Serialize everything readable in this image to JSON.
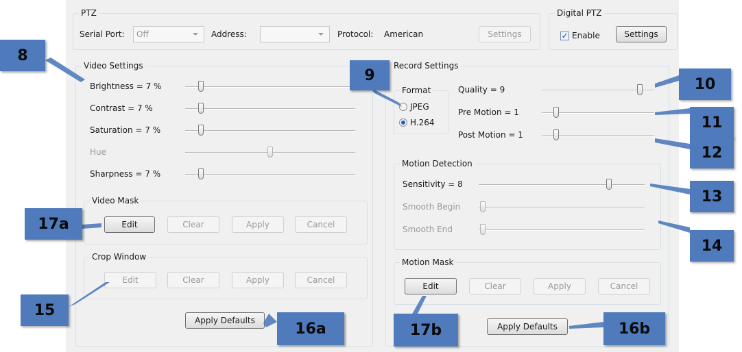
{
  "ptz": {
    "title": "PTZ",
    "serial_port_label": "Serial Port:",
    "serial_port_value": "Off",
    "address_label": "Address:",
    "address_value": "",
    "protocol_label": "Protocol:",
    "protocol_value": "American",
    "settings_label": "Settings"
  },
  "digital_ptz": {
    "title": "Digital PTZ",
    "enable_label": "Enable",
    "enable_checked": true,
    "settings_label": "Settings"
  },
  "video_settings": {
    "title": "Video Settings",
    "sliders": [
      {
        "label": "Brightness = 7 %",
        "value": 7,
        "enabled": true
      },
      {
        "label": "Contrast = 7 %",
        "value": 7,
        "enabled": true
      },
      {
        "label": "Saturation = 7 %",
        "value": 7,
        "enabled": true
      },
      {
        "label": "Hue",
        "value": 50,
        "enabled": false
      },
      {
        "label": "Sharpness = 7 %",
        "value": 7,
        "enabled": true
      }
    ],
    "video_mask": {
      "title": "Video Mask",
      "edit": "Edit",
      "clear": "Clear",
      "apply": "Apply",
      "cancel": "Cancel"
    },
    "crop_window": {
      "title": "Crop Window",
      "edit": "Edit",
      "clear": "Clear",
      "apply": "Apply",
      "cancel": "Cancel"
    },
    "apply_defaults": "Apply Defaults"
  },
  "record_settings": {
    "title": "Record Settings",
    "format": {
      "title": "Format",
      "options": [
        "JPEG",
        "H.264"
      ],
      "selected": "H.264"
    },
    "sliders": [
      {
        "label": "Quality = 9",
        "value": 9,
        "max": 10
      },
      {
        "label": "Pre Motion = 1",
        "value": 1,
        "max": 10
      },
      {
        "label": "Post Motion = 1",
        "value": 1,
        "max": 10
      }
    ],
    "motion_detection": {
      "title": "Motion Detection",
      "sliders": [
        {
          "label": "Sensitivity = 8",
          "value": 8,
          "max": 10,
          "enabled": true
        },
        {
          "label": "Smooth Begin",
          "value": 0,
          "max": 10,
          "enabled": false
        },
        {
          "label": "Smooth End",
          "value": 0,
          "max": 10,
          "enabled": false
        }
      ]
    },
    "motion_mask": {
      "title": "Motion Mask",
      "edit": "Edit",
      "clear": "Clear",
      "apply": "Apply",
      "cancel": "Cancel"
    },
    "apply_defaults": "Apply Defaults"
  },
  "callouts": [
    "8",
    "9",
    "10",
    "11",
    "12",
    "13",
    "14",
    "15",
    "16a",
    "16b",
    "17a",
    "17b"
  ],
  "colors": {
    "callout": "#4f7bbd",
    "panel": "#f0f0f0",
    "group_border": "#d5dfe5"
  }
}
